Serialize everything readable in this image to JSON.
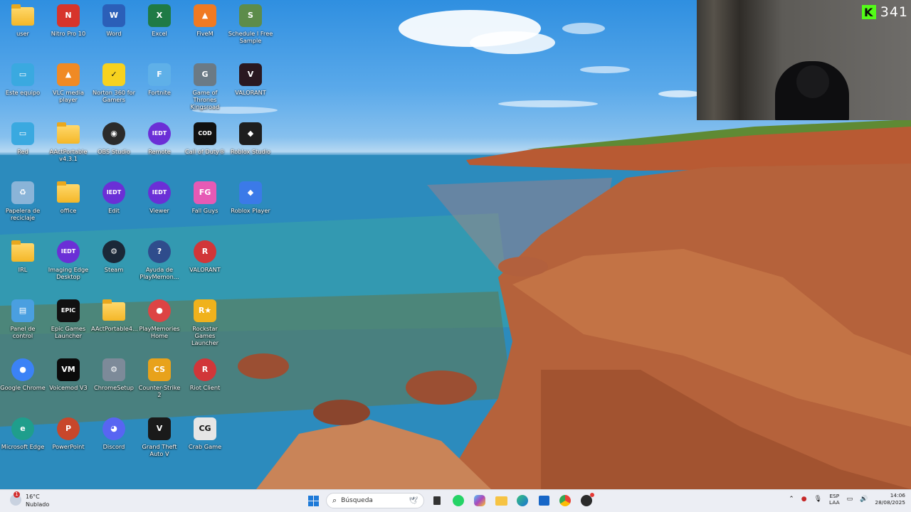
{
  "desktop": {
    "icons": [
      {
        "label": "user",
        "icon": "folder-icon",
        "glyph": "",
        "color": "#f4b728",
        "kind": "folder"
      },
      {
        "label": "Nitro Pro 10",
        "icon": "nitro-pdf-icon",
        "glyph": "N",
        "color": "#d7342b",
        "kind": "app"
      },
      {
        "label": "Word",
        "icon": "word-icon",
        "glyph": "W",
        "color": "#2b5fb8",
        "kind": "app"
      },
      {
        "label": "Excel",
        "icon": "excel-icon",
        "glyph": "X",
        "color": "#1f7a45",
        "kind": "app"
      },
      {
        "label": "FiveM",
        "icon": "fivem-icon",
        "glyph": "▲",
        "color": "#f07a22",
        "kind": "app"
      },
      {
        "label": "Schedule I Free Sample",
        "icon": "schedule-icon",
        "glyph": "S",
        "color": "#5d8c4a",
        "kind": "app"
      },
      {
        "label": "Este equipo",
        "icon": "computer-icon",
        "glyph": "▭",
        "color": "#3aa9e0",
        "kind": "app"
      },
      {
        "label": "VLC media player",
        "icon": "vlc-icon",
        "glyph": "▲",
        "color": "#f08a24",
        "kind": "app"
      },
      {
        "label": "Norton 360 for Gamers",
        "icon": "norton-icon",
        "glyph": "✓",
        "color": "#f7d21f",
        "kind": "app"
      },
      {
        "label": "Fortnite",
        "icon": "fortnite-icon",
        "glyph": "F",
        "color": "#5fb0e8",
        "kind": "app"
      },
      {
        "label": "Game of Thrones Kingsroad",
        "icon": "got-icon",
        "glyph": "G",
        "color": "#6b7a85",
        "kind": "app"
      },
      {
        "label": "VALORANT",
        "icon": "valorant-icon",
        "glyph": "V",
        "color": "#2a1820",
        "kind": "app"
      },
      {
        "label": "Red",
        "icon": "network-icon",
        "glyph": "▭",
        "color": "#3aa9e0",
        "kind": "app"
      },
      {
        "label": "AActPortable v4.3.1",
        "icon": "folder-icon",
        "glyph": "",
        "color": "#f4b728",
        "kind": "folder"
      },
      {
        "label": "OBS Studio",
        "icon": "obs-icon",
        "glyph": "◉",
        "color": "#2b2b2b",
        "kind": "round"
      },
      {
        "label": "Remote",
        "icon": "iedt-icon",
        "glyph": "IEDT",
        "color": "#6b2fd6",
        "kind": "round"
      },
      {
        "label": "Call of Duty®",
        "icon": "cod-icon",
        "glyph": "COD",
        "color": "#111111",
        "kind": "app"
      },
      {
        "label": "Roblox Studio",
        "icon": "roblox-studio-icon",
        "glyph": "◆",
        "color": "#1e1e1e",
        "kind": "app"
      },
      {
        "label": "Papelera de reciclaje",
        "icon": "recycle-bin-icon",
        "glyph": "♻",
        "color": "#8ab4d8",
        "kind": "app"
      },
      {
        "label": "office",
        "icon": "folder-icon",
        "glyph": "",
        "color": "#f4b728",
        "kind": "folder"
      },
      {
        "label": "Edit",
        "icon": "iedt-icon",
        "glyph": "IEDT",
        "color": "#6b2fd6",
        "kind": "round"
      },
      {
        "label": "Viewer",
        "icon": "iedt-icon",
        "glyph": "IEDT",
        "color": "#6b2fd6",
        "kind": "round"
      },
      {
        "label": "Fall Guys",
        "icon": "fall-guys-icon",
        "glyph": "FG",
        "color": "#e65ab5",
        "kind": "app"
      },
      {
        "label": "Roblox Player",
        "icon": "roblox-player-icon",
        "glyph": "◆",
        "color": "#3b7ae8",
        "kind": "app"
      },
      {
        "label": "IRL",
        "icon": "folder-icon",
        "glyph": "",
        "color": "#f4b728",
        "kind": "folder"
      },
      {
        "label": "Imaging Edge Desktop",
        "icon": "iedt-icon",
        "glyph": "IEDT",
        "color": "#6b2fd6",
        "kind": "round"
      },
      {
        "label": "Steam",
        "icon": "steam-icon",
        "glyph": "⚙",
        "color": "#1b2838",
        "kind": "round"
      },
      {
        "label": "Ayuda de PlayMemon...",
        "icon": "help-icon",
        "glyph": "?",
        "color": "#2f4c8c",
        "kind": "round"
      },
      {
        "label": "VALORANT",
        "icon": "riot-icon",
        "glyph": "R",
        "color": "#d13639",
        "kind": "round"
      },
      {
        "label": "Panel de control",
        "icon": "control-panel-icon",
        "glyph": "▤",
        "color": "#4a9fe0",
        "kind": "app"
      },
      {
        "label": "Epic Games Launcher",
        "icon": "epic-icon",
        "glyph": "EPIC",
        "color": "#111111",
        "kind": "app"
      },
      {
        "label": "AActPortable4...",
        "icon": "folder-icon",
        "glyph": "",
        "color": "#f4b728",
        "kind": "folder"
      },
      {
        "label": "PlayMemories Home",
        "icon": "playmemories-icon",
        "glyph": "●",
        "color": "#d44",
        "kind": "round"
      },
      {
        "label": "Rockstar Games Launcher",
        "icon": "rockstar-icon",
        "glyph": "R★",
        "color": "#f0b21c",
        "kind": "app"
      },
      {
        "label": "Google Chrome",
        "icon": "chrome-icon",
        "glyph": "●",
        "color": "#3b82f6",
        "kind": "round"
      },
      {
        "label": "Voicemod V3",
        "icon": "voicemod-icon",
        "glyph": "VM",
        "color": "#0b0b0b",
        "kind": "app"
      },
      {
        "label": "ChromeSetup",
        "icon": "setup-icon",
        "glyph": "⚙",
        "color": "#7d8a99",
        "kind": "app"
      },
      {
        "label": "Counter-Strike 2",
        "icon": "cs2-icon",
        "glyph": "CS",
        "color": "#e8a21b",
        "kind": "app"
      },
      {
        "label": "Riot Client",
        "icon": "riot-icon",
        "glyph": "R",
        "color": "#d13639",
        "kind": "round"
      },
      {
        "label": "Microsoft Edge",
        "icon": "edge-icon",
        "glyph": "e",
        "color": "#1f9e8c",
        "kind": "round"
      },
      {
        "label": "PowerPoint",
        "icon": "powerpoint-icon",
        "glyph": "P",
        "color": "#c8472b",
        "kind": "round"
      },
      {
        "label": "Discord",
        "icon": "discord-icon",
        "glyph": "◕",
        "color": "#5865f2",
        "kind": "round"
      },
      {
        "label": "Grand Theft Auto V",
        "icon": "gta-icon",
        "glyph": "V",
        "color": "#1a1a1a",
        "kind": "app"
      },
      {
        "label": "Crab Game",
        "icon": "crab-game-icon",
        "glyph": "CG",
        "color": "#e6e6e6",
        "kind": "app"
      }
    ]
  },
  "stream_overlay": {
    "platform_icon": "kick-icon",
    "platform_letter": "K",
    "viewer_count": "341"
  },
  "taskbar": {
    "weather": {
      "temperature": "16°C",
      "condition": "Nublado",
      "alert_count": "1"
    },
    "search_placeholder": "Búsqueda",
    "pinned": [
      "task-view-icon",
      "whatsapp-icon",
      "copilot-icon",
      "file-explorer-icon",
      "edge-icon",
      "store-icon",
      "chrome-icon",
      "obs-icon"
    ],
    "tray": {
      "lang_line1": "ESP",
      "lang_line2": "LAA",
      "time": "14:06",
      "date": "28/08/2025"
    }
  }
}
